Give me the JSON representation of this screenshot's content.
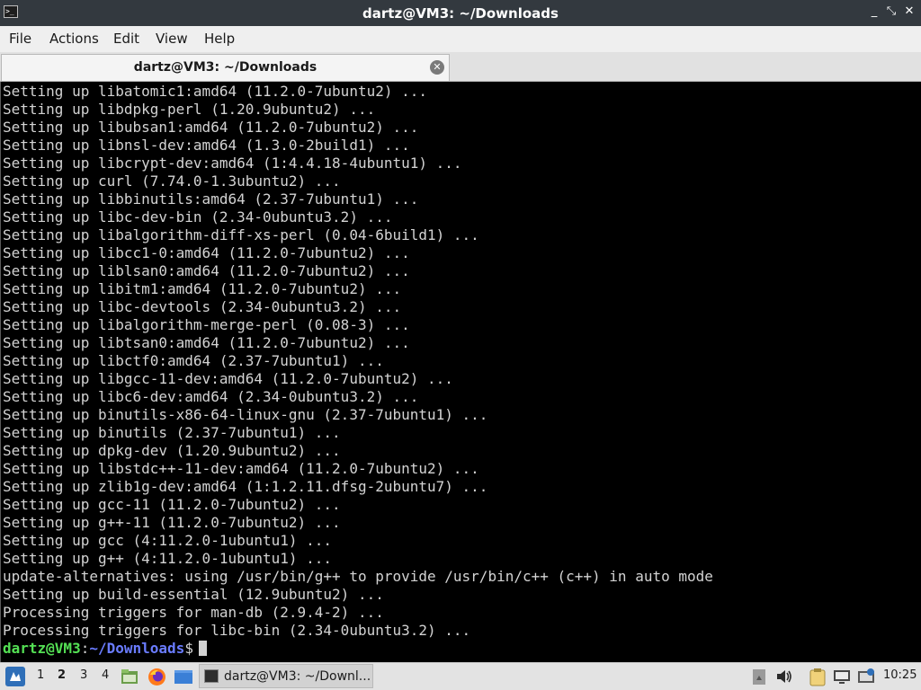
{
  "window": {
    "title": "dartz@VM3: ~/Downloads",
    "controls": {
      "minimize": "_",
      "maximize": "⤡",
      "close": "✕"
    }
  },
  "menubar": {
    "items": [
      "File",
      "Actions",
      "Edit",
      "View",
      "Help"
    ]
  },
  "tab": {
    "label": "dartz@VM3: ~/Downloads",
    "close_icon": "close-icon"
  },
  "terminal": {
    "lines": [
      "Setting up libatomic1:amd64 (11.2.0-7ubuntu2) ...",
      "Setting up libdpkg-perl (1.20.9ubuntu2) ...",
      "Setting up libubsan1:amd64 (11.2.0-7ubuntu2) ...",
      "Setting up libnsl-dev:amd64 (1.3.0-2build1) ...",
      "Setting up libcrypt-dev:amd64 (1:4.4.18-4ubuntu1) ...",
      "Setting up curl (7.74.0-1.3ubuntu2) ...",
      "Setting up libbinutils:amd64 (2.37-7ubuntu1) ...",
      "Setting up libc-dev-bin (2.34-0ubuntu3.2) ...",
      "Setting up libalgorithm-diff-xs-perl (0.04-6build1) ...",
      "Setting up libcc1-0:amd64 (11.2.0-7ubuntu2) ...",
      "Setting up liblsan0:amd64 (11.2.0-7ubuntu2) ...",
      "Setting up libitm1:amd64 (11.2.0-7ubuntu2) ...",
      "Setting up libc-devtools (2.34-0ubuntu3.2) ...",
      "Setting up libalgorithm-merge-perl (0.08-3) ...",
      "Setting up libtsan0:amd64 (11.2.0-7ubuntu2) ...",
      "Setting up libctf0:amd64 (2.37-7ubuntu1) ...",
      "Setting up libgcc-11-dev:amd64 (11.2.0-7ubuntu2) ...",
      "Setting up libc6-dev:amd64 (2.34-0ubuntu3.2) ...",
      "Setting up binutils-x86-64-linux-gnu (2.37-7ubuntu1) ...",
      "Setting up binutils (2.37-7ubuntu1) ...",
      "Setting up dpkg-dev (1.20.9ubuntu2) ...",
      "Setting up libstdc++-11-dev:amd64 (11.2.0-7ubuntu2) ...",
      "Setting up zlib1g-dev:amd64 (1:1.2.11.dfsg-2ubuntu7) ...",
      "Setting up gcc-11 (11.2.0-7ubuntu2) ...",
      "Setting up g++-11 (11.2.0-7ubuntu2) ...",
      "Setting up gcc (4:11.2.0-1ubuntu1) ...",
      "Setting up g++ (4:11.2.0-1ubuntu1) ...",
      "update-alternatives: using /usr/bin/g++ to provide /usr/bin/c++ (c++) in auto mode",
      "Setting up build-essential (12.9ubuntu2) ...",
      "Processing triggers for man-db (2.9.4-2) ...",
      "Processing triggers for libc-bin (2.34-0ubuntu3.2) ..."
    ],
    "prompt": {
      "user_host": "dartz@VM3",
      "separator": ":",
      "path": "~/Downloads",
      "symbol": "$"
    },
    "colors": {
      "background": "#000000",
      "text": "#d3d3d3",
      "prompt_user": "#54e054",
      "prompt_path": "#6a7cff"
    }
  },
  "taskbar": {
    "workspaces": [
      "1",
      "2",
      "3",
      "4"
    ],
    "active_workspace": "2",
    "task_label": "dartz@VM3: ~/Downl...",
    "clock": "10:25"
  }
}
